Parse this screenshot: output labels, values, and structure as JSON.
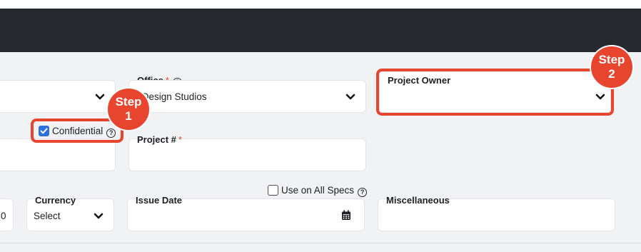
{
  "row1": {
    "office": {
      "label": "Office",
      "required": "*",
      "value": "l Design Studios"
    },
    "project_owner": {
      "label": "Project Owner",
      "value": ""
    }
  },
  "row2": {
    "confidential": {
      "label": "Confidential",
      "checked": true
    },
    "project_number": {
      "label": "Project #",
      "required": "*",
      "value": ""
    }
  },
  "row3": {
    "left_value": "0",
    "currency": {
      "label": "Currency",
      "value": "Select"
    },
    "use_on_all_specs": {
      "label": "Use on All Specs",
      "checked": false
    },
    "issue_date": {
      "label": "Issue Date",
      "value": ""
    },
    "miscellaneous": {
      "label": "Miscellaneous",
      "value": ""
    }
  },
  "annotations": {
    "step1": {
      "line1": "Step",
      "line2": "1"
    },
    "step2": {
      "line1": "Step",
      "line2": "2"
    }
  },
  "icons": {
    "help": "?",
    "chevron": "chevron-down-icon",
    "calendar": "calendar-icon",
    "check": "checkmark-icon"
  },
  "colors": {
    "topbar": "#26292d",
    "background": "#f1f2f4",
    "highlight": "#e8452f",
    "checkbox_on": "#2f6fde",
    "required": "#e0452c"
  }
}
